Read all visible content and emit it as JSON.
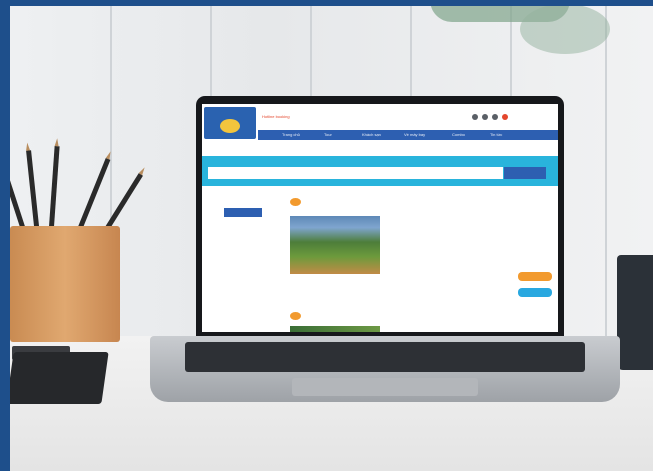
{
  "site": {
    "logo_text": "",
    "hotline": "Hotline booking",
    "nav": [
      "Trang chủ",
      "Tour",
      "Khách sạn",
      "Vé máy bay",
      "Combo",
      "Tin tức"
    ],
    "breadcrumb": "",
    "search_placeholder": "",
    "search_button": "",
    "filters": {
      "groups": [
        {
          "title": "",
          "items": [
            "",
            "",
            ""
          ],
          "more": ""
        },
        {
          "title": "",
          "items": [
            "",
            "",
            ""
          ],
          "more": ""
        }
      ],
      "apply_button": ""
    },
    "results": [
      {
        "title": "",
        "price_label": "",
        "description": "",
        "amenities": [
          "",
          "",
          ""
        ],
        "primary_button": "",
        "secondary_button": ""
      },
      {
        "title": ""
      }
    ]
  },
  "colors": {
    "frame": "#1e4f8b",
    "nav_blue": "#2d5fb1",
    "search_band": "#29b4dc",
    "accent_orange": "#f29a2e"
  }
}
